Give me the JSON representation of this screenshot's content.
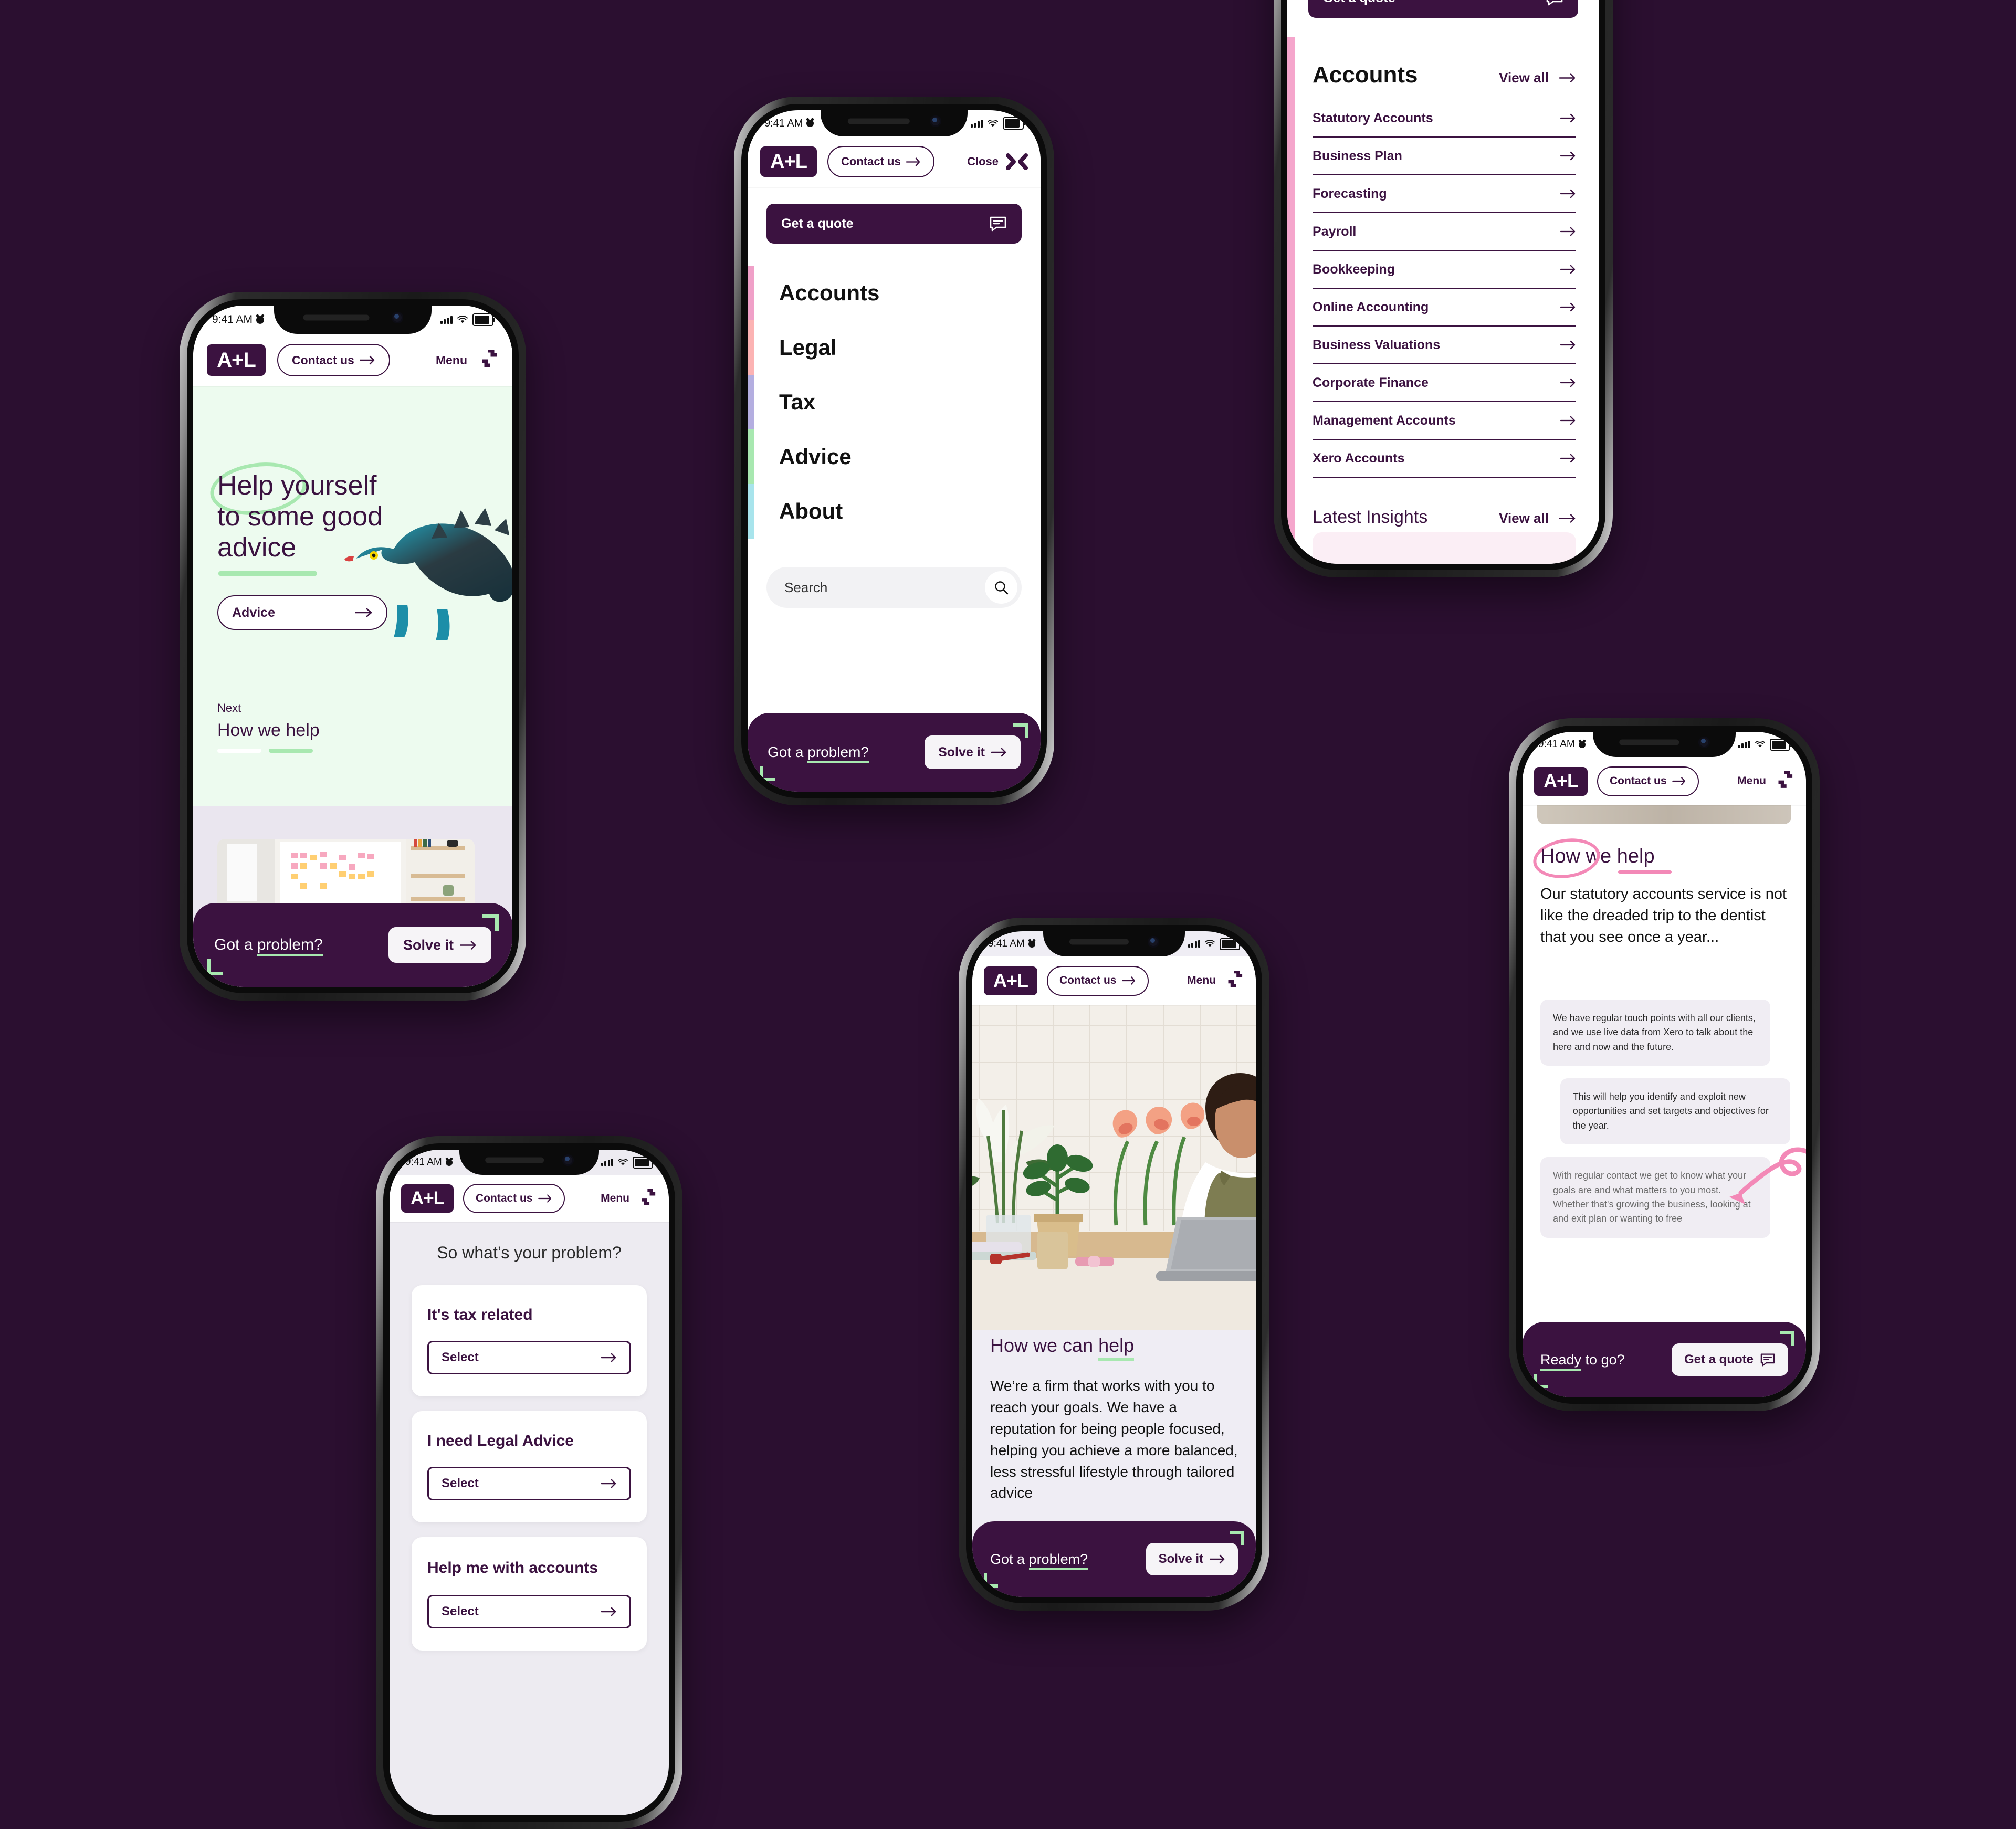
{
  "background_color": "#2B0F30",
  "brand": {
    "logo_text": "A+L",
    "accent_purple": "#3B1240",
    "accent_green": "#A8E8B0",
    "accent_pink": "#F389B7",
    "hero_bg": "#EDFBEF"
  },
  "status_bar": {
    "time": "9:41 AM"
  },
  "common": {
    "contact_label": "Contact us",
    "menu_label": "Menu",
    "close_label": "Close",
    "arrow_icon": "arrow-right-icon",
    "got_problem_prefix": "Got a ",
    "got_problem_underlined": "problem?",
    "solve_it_label": "Solve it"
  },
  "screens": [
    {
      "id": "home-hero",
      "name": "Help yourself to some good advice",
      "hero": {
        "headline_circled": "Help",
        "headline_rest": " yourself",
        "headline_line2": "to some good",
        "headline_line3_underlined": "advice",
        "cta_label": "Advice",
        "next_label": "Next",
        "next_title": "How we help"
      }
    },
    {
      "id": "main-menu",
      "name": "Main navigation menu",
      "quote_button": "Get a quote",
      "nav_items": [
        {
          "label": "Accounts",
          "stripe_color": "#F0A0C8"
        },
        {
          "label": "Legal",
          "stripe_color": "#FCB3B3"
        },
        {
          "label": "Tax",
          "stripe_color": "#B4AEE0"
        },
        {
          "label": "Advice",
          "stripe_color": "#A8E8B0"
        },
        {
          "label": "About",
          "stripe_color": "#A8E4EC"
        }
      ],
      "search_placeholder": "Search"
    },
    {
      "id": "accounts-submenu",
      "name": "Accounts services submenu",
      "quote_button": "Get a quote",
      "section_title": "Accounts",
      "view_all_label": "View all",
      "items": [
        "Statutory Accounts",
        "Business Plan",
        "Forecasting",
        "Payroll",
        "Bookkeeping",
        "Online Accounting",
        "Business Valuations",
        "Corporate Finance",
        "Management Accounts",
        "Xero Accounts"
      ],
      "latest_insights_title": "Latest Insights",
      "latest_insights_view_all": "View all"
    },
    {
      "id": "problem-picker",
      "name": "So what's your problem",
      "title": "So what’s your problem?",
      "cards": [
        {
          "title": "It's tax related",
          "button": "Select"
        },
        {
          "title": "I need Legal Advice",
          "button": "Select"
        },
        {
          "title": "Help me with accounts",
          "button": "Select"
        }
      ]
    },
    {
      "id": "how-we-can-help",
      "name": "How we can help article",
      "heading_plain": "How we can ",
      "heading_underlined": "help",
      "body": "We’re a firm that works with you to reach your goals. We have a reputation for being people focused, helping you achieve a more balanced, less stressful lifestyle through tailored advice"
    },
    {
      "id": "how-we-help-chat",
      "name": "How we help chat thread",
      "heading_circled": "How",
      "heading_mid": " we ",
      "heading_underlined": "help",
      "intro": "Our statutory accounts service is not like the dreaded trip to the dentist that you see once a year...",
      "bubbles": [
        "We have regular touch points with all our clients, and we use live data from Xero to talk about the here and now and the future.",
        "This will help you identify and exploit new opportunities and set targets and objectives for the year.",
        "With regular contact we get to know what your goals are and what matters to you most. Whether that's growing the business, looking at and exit plan or wanting to free"
      ],
      "footer_prefix": "Ready",
      "footer_rest": " to go?",
      "footer_button": "Get a quote"
    }
  ]
}
